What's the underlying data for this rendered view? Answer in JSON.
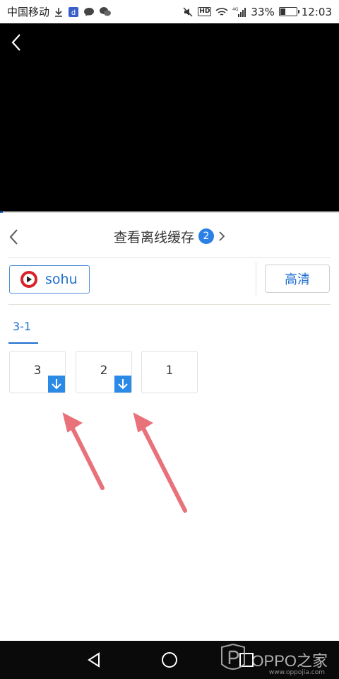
{
  "status_bar": {
    "carrier": "中国移动",
    "battery_percent": "33%",
    "battery_level": 0.33,
    "network": "4G",
    "time": "12:03",
    "hd_label": "HD"
  },
  "panel": {
    "title": "查看离线缓存",
    "count": "2"
  },
  "source": {
    "label": "sohu",
    "quality": "高清"
  },
  "tabs": [
    {
      "label": "3-1",
      "selected": true
    }
  ],
  "episodes": [
    {
      "number": "3",
      "downloading": true
    },
    {
      "number": "2",
      "downloading": true
    },
    {
      "number": "1",
      "downloading": false
    }
  ],
  "watermark": {
    "brand": "OPPO之家",
    "url": "www.oppojia.com"
  },
  "colors": {
    "accent": "#2b8ae6",
    "arrow": "#e8717a"
  }
}
